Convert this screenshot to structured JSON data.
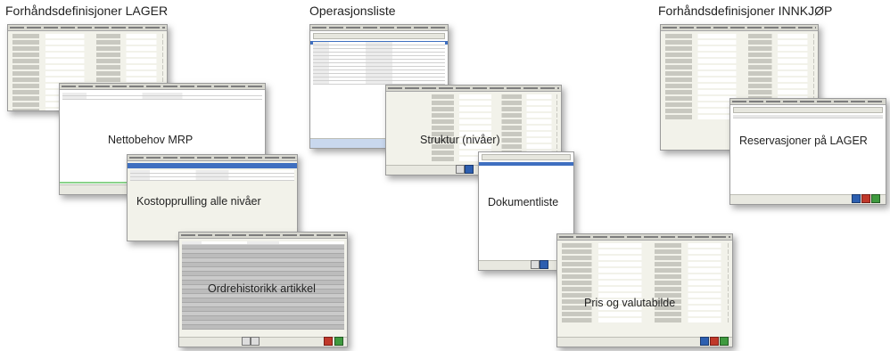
{
  "headings": {
    "lager": "Forhåndsdefinisjoner LAGER",
    "operasjonsliste": "Operasjonsliste",
    "innkjop": "Forhåndsdefinisjoner INNKJØP"
  },
  "panels": {
    "nettobehov": "Nettobehov MRP",
    "kostopprulling": "Kostopprulling alle nivåer",
    "ordrehistorikk": "Ordrehistorikk artikkel",
    "struktur": "Struktur (nivåer)",
    "dokumentliste": "Dokumentliste",
    "reservasjoner": "Reservasjoner på LAGER",
    "pris": "Pris og valutabilde"
  },
  "colors": {
    "accent_blue": "#3f6fc0",
    "window_bg": "#f2f2ea",
    "grid_gray": "#bcbcbc"
  }
}
